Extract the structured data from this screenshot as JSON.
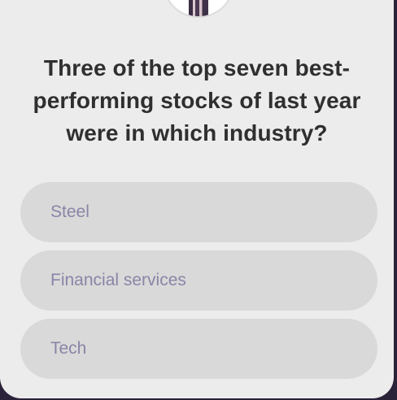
{
  "question": {
    "text": "Three of the top seven best-performing stocks of last year were in which industry?"
  },
  "answers": [
    {
      "label": "Steel"
    },
    {
      "label": "Financial services"
    },
    {
      "label": "Tech"
    }
  ],
  "colors": {
    "card_background": "#ececec",
    "answer_background": "#d9d9d9",
    "answer_text": "#8b84a7",
    "question_text": "#2f2f2f",
    "outer_background": "#2a2238"
  }
}
